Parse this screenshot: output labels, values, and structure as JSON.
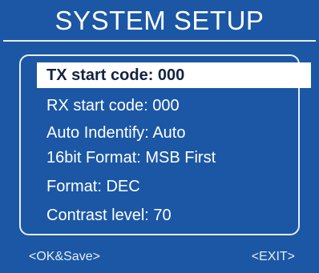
{
  "screen": {
    "title": "SYSTEM SETUP",
    "colors": {
      "background": "#1b57a4",
      "text": "#ffffff",
      "highlight_bg": "#ffffff",
      "highlight_text": "#12233f"
    }
  },
  "menu": {
    "selected_index": 0,
    "items": [
      {
        "label": "TX start code: 000"
      },
      {
        "label": "RX start code: 000"
      },
      {
        "label": "Auto Indentify: Auto"
      },
      {
        "label": "16bit Format: MSB First"
      },
      {
        "label": "Format: DEC"
      },
      {
        "label": "Contrast level: 70"
      }
    ]
  },
  "footer": {
    "ok_label": "<OK&Save>",
    "exit_label": "<EXIT>"
  }
}
